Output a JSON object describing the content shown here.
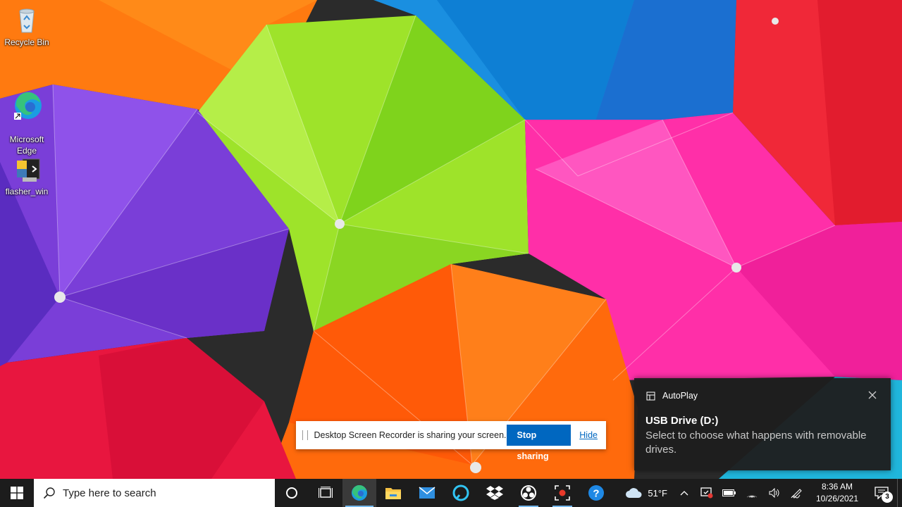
{
  "desktop": {
    "icons": [
      {
        "label": "Recycle Bin",
        "icon": "recycle-bin-icon"
      },
      {
        "label": "Microsoft\nEdge",
        "icon": "edge-icon"
      },
      {
        "label": "flasher_win",
        "icon": "python-file-icon"
      }
    ]
  },
  "share_bar": {
    "message": "Desktop Screen Recorder is sharing your screen.",
    "stop_label": "Stop sharing",
    "hide_label": "Hide"
  },
  "toast": {
    "app": "AutoPlay",
    "title": "USB Drive (D:)",
    "body": "Select to choose what happens with removable drives."
  },
  "taskbar": {
    "search_placeholder": "Type here to search",
    "apps": [
      "cortana-icon",
      "task-view-icon",
      "edge-icon",
      "file-explorer-icon",
      "mail-icon",
      "alexa-icon",
      "dropbox-icon",
      "obs-icon",
      "screen-recorder-icon",
      "help-icon"
    ],
    "weather": {
      "temp": "51°F",
      "icon": "cloud-icon"
    },
    "clock": {
      "time": "8:36 AM",
      "date": "10/26/2021"
    },
    "notifications": "3"
  },
  "colors": {
    "accent": "#0067c0",
    "taskbar": "#1c1c1c",
    "toast": "#1e1e1e"
  }
}
